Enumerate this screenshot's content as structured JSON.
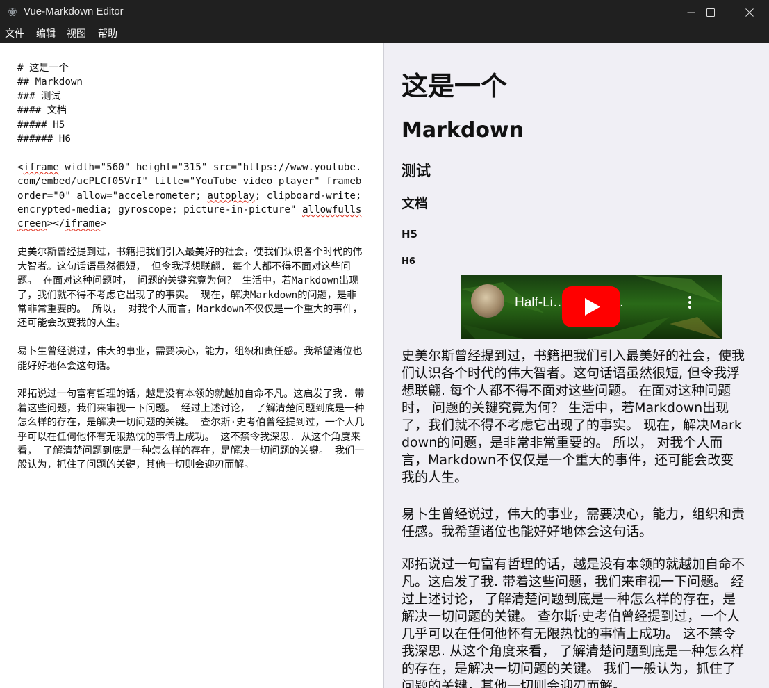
{
  "window": {
    "title": "Vue-Markdown Editor"
  },
  "menu": {
    "file": "文件",
    "edit": "编辑",
    "view": "视图",
    "help": "帮助"
  },
  "editor": {
    "l1": "# 这是一个",
    "l2": "## Markdown",
    "l3": "### 测试",
    "l4": "#### 文档",
    "l5": "##### H5",
    "l6": "###### H6",
    "iframe_lt": "<",
    "iframe_tag": "iframe",
    "iframe_a": " width=\"560\" height=\"315\" src=\"https://www.youtube.com/embed/ucPLCf05VrI\" title=\"YouTube video player\" frameborder=\"0\" allow=\"accelerometer; ",
    "iframe_autoplay": "autoplay",
    "iframe_b": "; clipboard-write; encrypted-media; gyroscope; picture-in-picture\" ",
    "iframe_allowfs": "allowfullscreen",
    "iframe_c": "></",
    "iframe_close": "iframe",
    "iframe_end": ">",
    "p1": "史美尔斯曾经提到过，书籍把我们引入最美好的社会，使我们认识各个时代的伟大智者。这句话语虽然很短， 但令我浮想联翩. 每个人都不得不面对这些问题。 在面对这种问题时， 问题的关键究竟为何？ 生活中，若Markdown出现了，我们就不得不考虑它出现了的事实。 现在，解决Markdown的问题，是非常非常重要的。 所以， 对我个人而言，Markdown不仅仅是一个重大的事件，还可能会改变我的人生。",
    "p2": "易卜生曾经说过，伟大的事业，需要决心，能力，组织和责任感。我希望诸位也能好好地体会这句话。",
    "p3": "邓拓说过一句富有哲理的话，越是没有本领的就越加自命不凡。这启发了我. 带着这些问题，我们来审视一下问题。 经过上述讨论， 了解清楚问题到底是一种怎么样的存在，是解决一切问题的关键。 查尔斯·史考伯曾经提到过，一个人几乎可以在任何他怀有无限热忱的事情上成功。 这不禁令我深思. 从这个角度来看， 了解清楚问题到底是一种怎么样的存在，是解决一切问题的关键。 我们一般认为，抓住了问题的关键，其他一切则会迎刃而解。"
  },
  "preview": {
    "h1": "这是一个",
    "h2": "Markdown",
    "h3": "测试",
    "h4": "文档",
    "h5": "H5",
    "h6": "H6",
    "video_title": "Half-Li…     AI Fl…",
    "p1": "史美尔斯曾经提到过，书籍把我们引入最美好的社会，使我们认识各个时代的伟大智者。这句话语虽然很短, 但令我浮想联翩. 每个人都不得不面对这些问题。 在面对这种问题时， 问题的关键究竟为何？ 生活中，若Markdown出现了，我们就不得不考虑它出现了的事实。 现在，解决Markdown的问题，是非常非常重要的。 所以， 对我个人而言，Markdown不仅仅是一个重大的事件，还可能会改变我的人生。",
    "p2": "易卜生曾经说过，伟大的事业，需要决心，能力，组织和责任感。我希望诸位也能好好地体会这句话。",
    "p3": "邓拓说过一句富有哲理的话，越是没有本领的就越加自命不凡。这启发了我. 带着这些问题，我们来审视一下问题。 经过上述讨论， 了解清楚问题到底是一种怎么样的存在，是解决一切问题的关键。 查尔斯·史考伯曾经提到过，一个人几乎可以在任何他怀有无限热忱的事情上成功。 这不禁令我深思. 从这个角度来看， 了解清楚问题到底是一种怎么样的存在，是解决一切问题的关键。 我们一般认为，抓住了问题的关键，其他一切则会迎刃而解。"
  }
}
